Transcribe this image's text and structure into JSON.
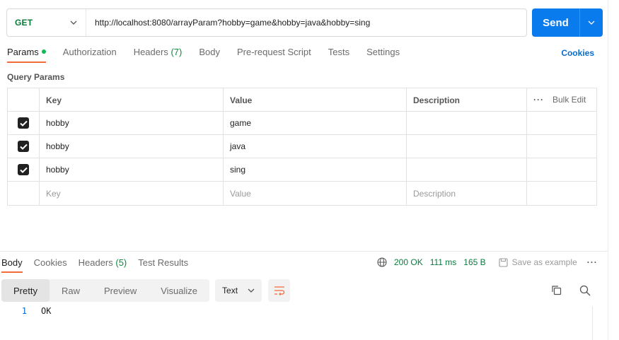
{
  "request": {
    "method": "GET",
    "url": "http://localhost:8080/arrayParam?hobby=game&hobby=java&hobby=sing",
    "send_label": "Send"
  },
  "request_tabs": {
    "params": "Params",
    "authorization": "Authorization",
    "headers": "Headers",
    "headers_count": "(7)",
    "body": "Body",
    "prerequest": "Pre-request Script",
    "tests": "Tests",
    "settings": "Settings",
    "cookies": "Cookies"
  },
  "query_params": {
    "title": "Query Params",
    "headers": {
      "key": "Key",
      "value": "Value",
      "description": "Description",
      "bulk_edit": "Bulk Edit"
    },
    "rows": [
      {
        "key": "hobby",
        "value": "game",
        "description": "",
        "checked": true
      },
      {
        "key": "hobby",
        "value": "java",
        "description": "",
        "checked": true
      },
      {
        "key": "hobby",
        "value": "sing",
        "description": "",
        "checked": true
      }
    ],
    "placeholders": {
      "key": "Key",
      "value": "Value",
      "description": "Description"
    }
  },
  "response": {
    "tabs": {
      "body": "Body",
      "cookies": "Cookies",
      "headers": "Headers",
      "headers_count": "(5)",
      "test_results": "Test Results"
    },
    "status": "200 OK",
    "time": "111 ms",
    "size": "165 B",
    "save_example": "Save as example",
    "view_modes": [
      "Pretty",
      "Raw",
      "Preview",
      "Visualize"
    ],
    "format": "Text",
    "lines": [
      {
        "num": "1",
        "text": "OK"
      }
    ]
  },
  "colors": {
    "accent": "#f26b3a",
    "send": "#097bed",
    "method": "#0a7b3c",
    "link": "#0b6bcb"
  }
}
